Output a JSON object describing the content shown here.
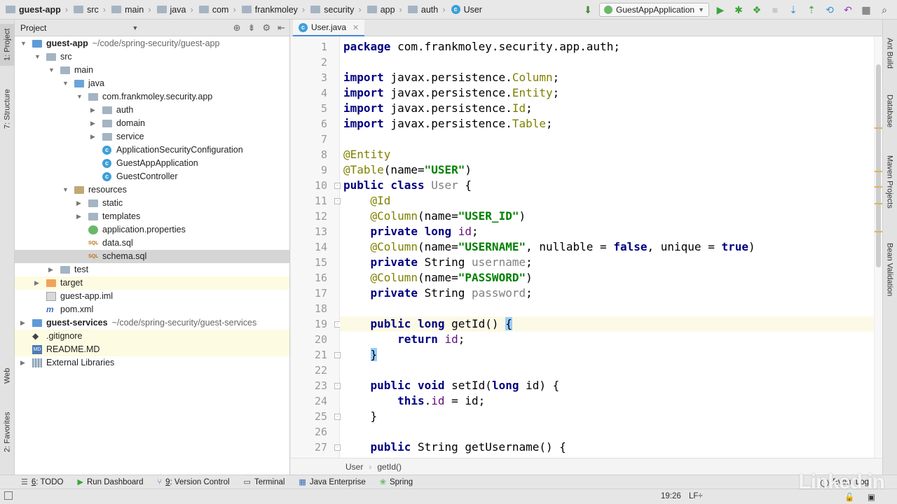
{
  "breadcrumb": [
    {
      "label": "guest-app",
      "bold": true
    },
    {
      "label": "src"
    },
    {
      "label": "main"
    },
    {
      "label": "java"
    },
    {
      "label": "com"
    },
    {
      "label": "frankmoley"
    },
    {
      "label": "security"
    },
    {
      "label": "app"
    },
    {
      "label": "auth"
    },
    {
      "label": "User",
      "cls": true
    }
  ],
  "run_config": "GuestAppApplication",
  "left_tabs": [
    "1: Project",
    "7: Structure",
    "Web",
    "2: Favorites"
  ],
  "right_tabs": [
    "Ant Build",
    "Database",
    "Maven Projects",
    "Bean Validation"
  ],
  "project_panel": {
    "title": "Project",
    "tree": [
      {
        "label": "guest-app",
        "path": "~/code/spring-security/guest-app",
        "depth": 0,
        "arrow": "down",
        "icon": "module-folder",
        "bold": true
      },
      {
        "label": "src",
        "depth": 1,
        "arrow": "down",
        "icon": "folder"
      },
      {
        "label": "main",
        "depth": 2,
        "arrow": "down",
        "icon": "folder"
      },
      {
        "label": "java",
        "depth": 3,
        "arrow": "down",
        "icon": "src-folder"
      },
      {
        "label": "com.frankmoley.security.app",
        "depth": 4,
        "arrow": "down",
        "icon": "folder"
      },
      {
        "label": "auth",
        "depth": 5,
        "arrow": "right",
        "icon": "folder"
      },
      {
        "label": "domain",
        "depth": 5,
        "arrow": "right",
        "icon": "folder"
      },
      {
        "label": "service",
        "depth": 5,
        "arrow": "right",
        "icon": "folder"
      },
      {
        "label": "ApplicationSecurityConfiguration",
        "depth": 5,
        "arrow": "",
        "icon": "class"
      },
      {
        "label": "GuestAppApplication",
        "depth": 5,
        "arrow": "",
        "icon": "class"
      },
      {
        "label": "GuestController",
        "depth": 5,
        "arrow": "",
        "icon": "class"
      },
      {
        "label": "resources",
        "depth": 3,
        "arrow": "down",
        "icon": "res-folder"
      },
      {
        "label": "static",
        "depth": 4,
        "arrow": "right",
        "icon": "folder"
      },
      {
        "label": "templates",
        "depth": 4,
        "arrow": "right",
        "icon": "folder"
      },
      {
        "label": "application.properties",
        "depth": 4,
        "arrow": "",
        "icon": "properties"
      },
      {
        "label": "data.sql",
        "depth": 4,
        "arrow": "",
        "icon": "sql"
      },
      {
        "label": "schema.sql",
        "depth": 4,
        "arrow": "",
        "icon": "sql",
        "selected": true
      },
      {
        "label": "test",
        "depth": 2,
        "arrow": "right",
        "icon": "folder"
      },
      {
        "label": "target",
        "depth": 1,
        "arrow": "right",
        "icon": "excluded-folder",
        "ignored": true
      },
      {
        "label": "guest-app.iml",
        "depth": 1,
        "arrow": "",
        "icon": "file"
      },
      {
        "label": "pom.xml",
        "depth": 1,
        "arrow": "",
        "icon": "xml"
      },
      {
        "label": "guest-services",
        "path": "~/code/spring-security/guest-services",
        "depth": 0,
        "arrow": "right",
        "icon": "module-folder",
        "bold": true
      },
      {
        "label": ".gitignore",
        "depth": 0,
        "arrow": "",
        "icon": "git",
        "ignored": true
      },
      {
        "label": "README.MD",
        "depth": 0,
        "arrow": "",
        "icon": "md",
        "ignored": true
      },
      {
        "label": "External Libraries",
        "depth": 0,
        "arrow": "right",
        "icon": "library"
      }
    ]
  },
  "editor": {
    "tab": "User.java",
    "current_line": 19,
    "lines": [
      [
        [
          "kw",
          "package"
        ],
        [
          "t",
          " com.frankmoley.security.app.auth;"
        ]
      ],
      [],
      [
        [
          "kw",
          "import"
        ],
        [
          "t",
          " javax.persistence."
        ],
        [
          "ann",
          "Column"
        ],
        [
          "t",
          ";"
        ]
      ],
      [
        [
          "kw",
          "import"
        ],
        [
          "t",
          " javax.persistence."
        ],
        [
          "ann",
          "Entity"
        ],
        [
          "t",
          ";"
        ]
      ],
      [
        [
          "kw",
          "import"
        ],
        [
          "t",
          " javax.persistence."
        ],
        [
          "ann",
          "Id"
        ],
        [
          "t",
          ";"
        ]
      ],
      [
        [
          "kw",
          "import"
        ],
        [
          "t",
          " javax.persistence."
        ],
        [
          "ann",
          "Table"
        ],
        [
          "t",
          ";"
        ]
      ],
      [],
      [
        [
          "ann",
          "@Entity"
        ]
      ],
      [
        [
          "ann",
          "@Table"
        ],
        [
          "t",
          "(name="
        ],
        [
          "str",
          "\"USER\""
        ],
        [
          "t",
          ")"
        ]
      ],
      [
        [
          "kw",
          "public class"
        ],
        [
          "t",
          " "
        ],
        [
          "unused",
          "User"
        ],
        [
          "t",
          " {"
        ]
      ],
      [
        [
          "t",
          "    "
        ],
        [
          "ann",
          "@Id"
        ]
      ],
      [
        [
          "t",
          "    "
        ],
        [
          "ann",
          "@Column"
        ],
        [
          "t",
          "(name="
        ],
        [
          "str",
          "\"USER_ID\""
        ],
        [
          "t",
          ")"
        ]
      ],
      [
        [
          "t",
          "    "
        ],
        [
          "kw",
          "private long"
        ],
        [
          "t",
          " "
        ],
        [
          "fld",
          "id"
        ],
        [
          "t",
          ";"
        ]
      ],
      [
        [
          "t",
          "    "
        ],
        [
          "ann",
          "@Column"
        ],
        [
          "t",
          "(name="
        ],
        [
          "str",
          "\"USERNAME\""
        ],
        [
          "t",
          ", nullable = "
        ],
        [
          "kw",
          "false"
        ],
        [
          "t",
          ", unique = "
        ],
        [
          "kw",
          "true"
        ],
        [
          "t",
          ")"
        ]
      ],
      [
        [
          "t",
          "    "
        ],
        [
          "kw",
          "private"
        ],
        [
          "t",
          " String "
        ],
        [
          "unused",
          "username"
        ],
        [
          "t",
          ";"
        ]
      ],
      [
        [
          "t",
          "    "
        ],
        [
          "ann",
          "@Column"
        ],
        [
          "t",
          "(name="
        ],
        [
          "str",
          "\"PASSWORD\""
        ],
        [
          "t",
          ")"
        ]
      ],
      [
        [
          "t",
          "    "
        ],
        [
          "kw",
          "private"
        ],
        [
          "t",
          " String "
        ],
        [
          "unused",
          "password"
        ],
        [
          "t",
          ";"
        ]
      ],
      [],
      [
        [
          "t",
          "    "
        ],
        [
          "kw",
          "public long"
        ],
        [
          "t",
          " getId() "
        ],
        [
          "brace",
          "{"
        ]
      ],
      [
        [
          "t",
          "        "
        ],
        [
          "kw",
          "return"
        ],
        [
          "t",
          " "
        ],
        [
          "fld",
          "id"
        ],
        [
          "t",
          ";"
        ]
      ],
      [
        [
          "t",
          "    "
        ],
        [
          "brace",
          "}"
        ]
      ],
      [],
      [
        [
          "t",
          "    "
        ],
        [
          "kw",
          "public void"
        ],
        [
          "t",
          " setId("
        ],
        [
          "kw",
          "long"
        ],
        [
          "t",
          " id) {"
        ]
      ],
      [
        [
          "t",
          "        "
        ],
        [
          "kw",
          "this"
        ],
        [
          "t",
          "."
        ],
        [
          "fld",
          "id"
        ],
        [
          "t",
          " = id;"
        ]
      ],
      [
        [
          "t",
          "    }"
        ]
      ],
      [],
      [
        [
          "t",
          "    "
        ],
        [
          "kw",
          "public"
        ],
        [
          "t",
          " String getUsername() {"
        ]
      ]
    ],
    "fold_lines": [
      10,
      11,
      19,
      21,
      23,
      25,
      27
    ],
    "breadcrumb": [
      "User",
      "getId()"
    ]
  },
  "bottom_tools": [
    {
      "key": "6",
      "label": "TODO",
      "icon": "todo-icon"
    },
    {
      "key": "",
      "label": "Run Dashboard",
      "icon": "run-icon"
    },
    {
      "key": "9",
      "label": "Version Control",
      "icon": "vcs-icon"
    },
    {
      "key": "",
      "label": "Terminal",
      "icon": "terminal-icon"
    },
    {
      "key": "",
      "label": "Java Enterprise",
      "icon": "java-ee-icon"
    },
    {
      "key": "",
      "label": "Spring",
      "icon": "spring-icon"
    }
  ],
  "event_log": "Event Log",
  "status": {
    "position": "19:26",
    "line_sep": "LF÷"
  },
  "watermark": "Linked in"
}
